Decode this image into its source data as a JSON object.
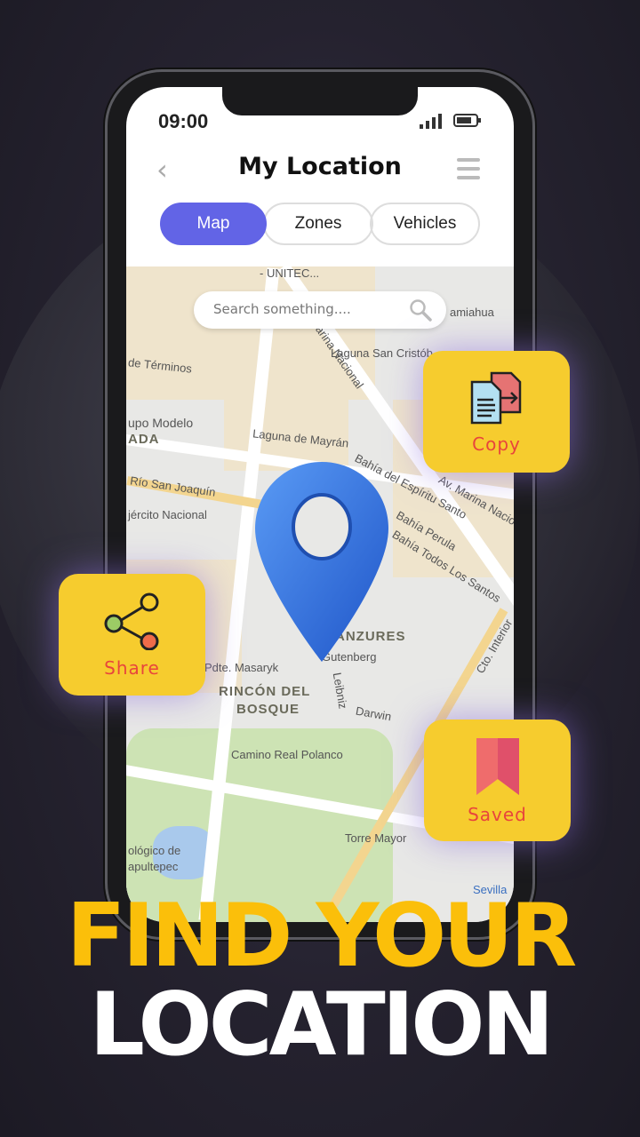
{
  "status_bar": {
    "time": "09:00"
  },
  "header": {
    "title": "My Location",
    "back_icon": "chevron-left-icon",
    "menu_icon": "hamburger-icon"
  },
  "tabs": [
    {
      "label": "Map",
      "active": true
    },
    {
      "label": "Zones",
      "active": false
    },
    {
      "label": "Vehicles",
      "active": false
    }
  ],
  "search": {
    "placeholder": "Search something...."
  },
  "map_labels": [
    "- UNITEC...",
    "Laguna San Cristób",
    "Marina Nacional",
    "de Términos",
    "upo Modelo",
    "ADA",
    "Laguna de Mayrán",
    "Río San Joaquín",
    "jército Nacional",
    "Bahía del Espíritu Santo",
    "Bahía Perula",
    "Bahía Todos Los Santos",
    "Av. Marina Nacional",
    "ANZURES",
    "Gutenberg",
    "Pdte. Masaryk",
    "RINCÓN DEL",
    "BOSQUE",
    "Darwin",
    "Leibniz",
    "Camino Real Polanco",
    "Torre Mayor",
    "ológico de",
    "apultepec",
    "Cto. Interior",
    "amiahua",
    "Sevilla"
  ],
  "actions": [
    {
      "label": "Copy",
      "icon": "copy-document-icon"
    },
    {
      "label": "Share",
      "icon": "share-icon"
    },
    {
      "label": "Saved",
      "icon": "bookmark-icon"
    }
  ],
  "headline": {
    "line1": "FIND YOUR",
    "line2": "LOCATION"
  },
  "colors": {
    "accent": "#6264e6",
    "card": "#f6cc2e",
    "card_text": "#e8453c",
    "headline_yellow": "#fbbf0a",
    "pin": "#2f6fe0"
  }
}
